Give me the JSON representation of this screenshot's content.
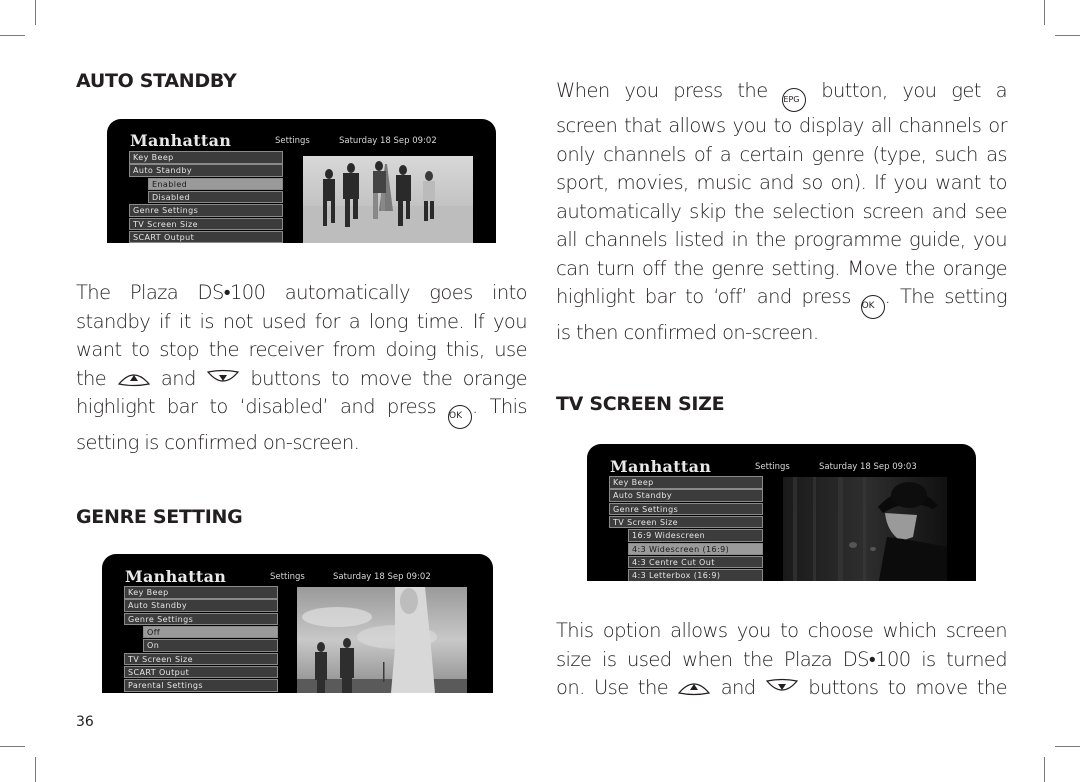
{
  "page_number": "36",
  "sections": {
    "auto_standby": {
      "heading": "AUTO STANDBY",
      "screen": {
        "brand": "Manhattan",
        "section": "Settings",
        "datetime": "Saturday 18 Sep  09:02",
        "menu": [
          {
            "label": "Key Beep",
            "level": 0,
            "highlighted": false
          },
          {
            "label": "Auto Standby",
            "level": 0,
            "highlighted": false
          },
          {
            "label": "Enabled",
            "level": 1,
            "highlighted": true
          },
          {
            "label": "Disabled",
            "level": 1,
            "highlighted": false
          },
          {
            "label": "Genre Settings",
            "level": 0,
            "highlighted": false
          },
          {
            "label": "TV Screen Size",
            "level": 0,
            "highlighted": false
          },
          {
            "label": "SCART Output",
            "level": 0,
            "highlighted": false
          }
        ],
        "picture": "group-jumping-eiffel-tower"
      },
      "body_lines": [
        "The Plaza DS•100 automatically goes into",
        "standby if it is not used for a long time. If you",
        "want to stop the receiver from doing this, use",
        "the [UP] and [DOWN] buttons to move the orange",
        "highlight bar to ‘disabled’ and press [OK]. This",
        "setting is confirmed on-screen."
      ],
      "line4": {
        "pre": "the",
        "mid": "and",
        "post": "buttons to move the orange"
      },
      "line5": {
        "pre": "highlight bar to ‘disabled’ and press",
        "post": ". This"
      }
    },
    "genre_setting": {
      "heading": "GENRE SETTING",
      "screen": {
        "brand": "Manhattan",
        "section": "Settings",
        "datetime": "Saturday 18 Sep  09:02",
        "menu": [
          {
            "label": "Key Beep",
            "level": 0,
            "highlighted": false
          },
          {
            "label": "Auto Standby",
            "level": 0,
            "highlighted": false
          },
          {
            "label": "Genre Settings",
            "level": 0,
            "highlighted": false
          },
          {
            "label": "Off",
            "level": 1,
            "highlighted": true
          },
          {
            "label": "On",
            "level": 1,
            "highlighted": false
          },
          {
            "label": "TV Screen Size",
            "level": 0,
            "highlighted": false
          },
          {
            "label": "SCART Output",
            "level": 0,
            "highlighted": false
          },
          {
            "label": "Parental Settings",
            "level": 0,
            "highlighted": false
          }
        ],
        "picture": "woman-and-couple-sky"
      },
      "body_lines": [
        "When you press the [EPG] button, you get a",
        "screen that allows you to display all channels or",
        "only channels of a certain genre (type, such as",
        "sport, movies, music and so on). If you want to",
        "automatically skip the selection screen and see",
        "all channels listed in the programme guide, you",
        "can turn off the genre setting. Move the orange",
        "highlight bar to ‘off’ and press [OK]. The setting",
        "is then confirmed on-screen."
      ],
      "line1": {
        "pre": "When you press the",
        "post": "button, you get a"
      },
      "line8": {
        "pre": "highlight bar to ‘off’ and press",
        "post": ". The setting"
      }
    },
    "tv_screen_size": {
      "heading": "TV SCREEN SIZE",
      "screen": {
        "brand": "Manhattan",
        "section": "Settings",
        "datetime": "Saturday 18 Sep  09:03",
        "menu": [
          {
            "label": "Key Beep",
            "level": 0,
            "highlighted": false
          },
          {
            "label": "Auto Standby",
            "level": 0,
            "highlighted": false
          },
          {
            "label": "Genre Settings",
            "level": 0,
            "highlighted": false
          },
          {
            "label": "TV Screen Size",
            "level": 0,
            "highlighted": false
          },
          {
            "label": "16:9 Widescreen",
            "level": 1,
            "highlighted": false
          },
          {
            "label": "4:3 Widescreen (16:9)",
            "level": 1,
            "highlighted": true
          },
          {
            "label": "4:3 Centre Cut Out",
            "level": 1,
            "highlighted": false
          },
          {
            "label": "4:3 Letterbox (16:9)",
            "level": 1,
            "highlighted": false
          }
        ],
        "picture": "man-in-hat"
      },
      "body_lines": [
        "This option allows you to choose which screen",
        "size is used when the Plaza DS•100 is turned",
        "on. Use the [UP] and [DOWN] buttons to move the"
      ],
      "line3": {
        "pre": "on. Use the",
        "mid": "and",
        "post": "buttons to move the"
      }
    }
  },
  "buttons": {
    "ok": "OK",
    "epg": "EPG",
    "up_icon": "up-arrow-button-icon",
    "down_icon": "down-arrow-button-icon"
  }
}
